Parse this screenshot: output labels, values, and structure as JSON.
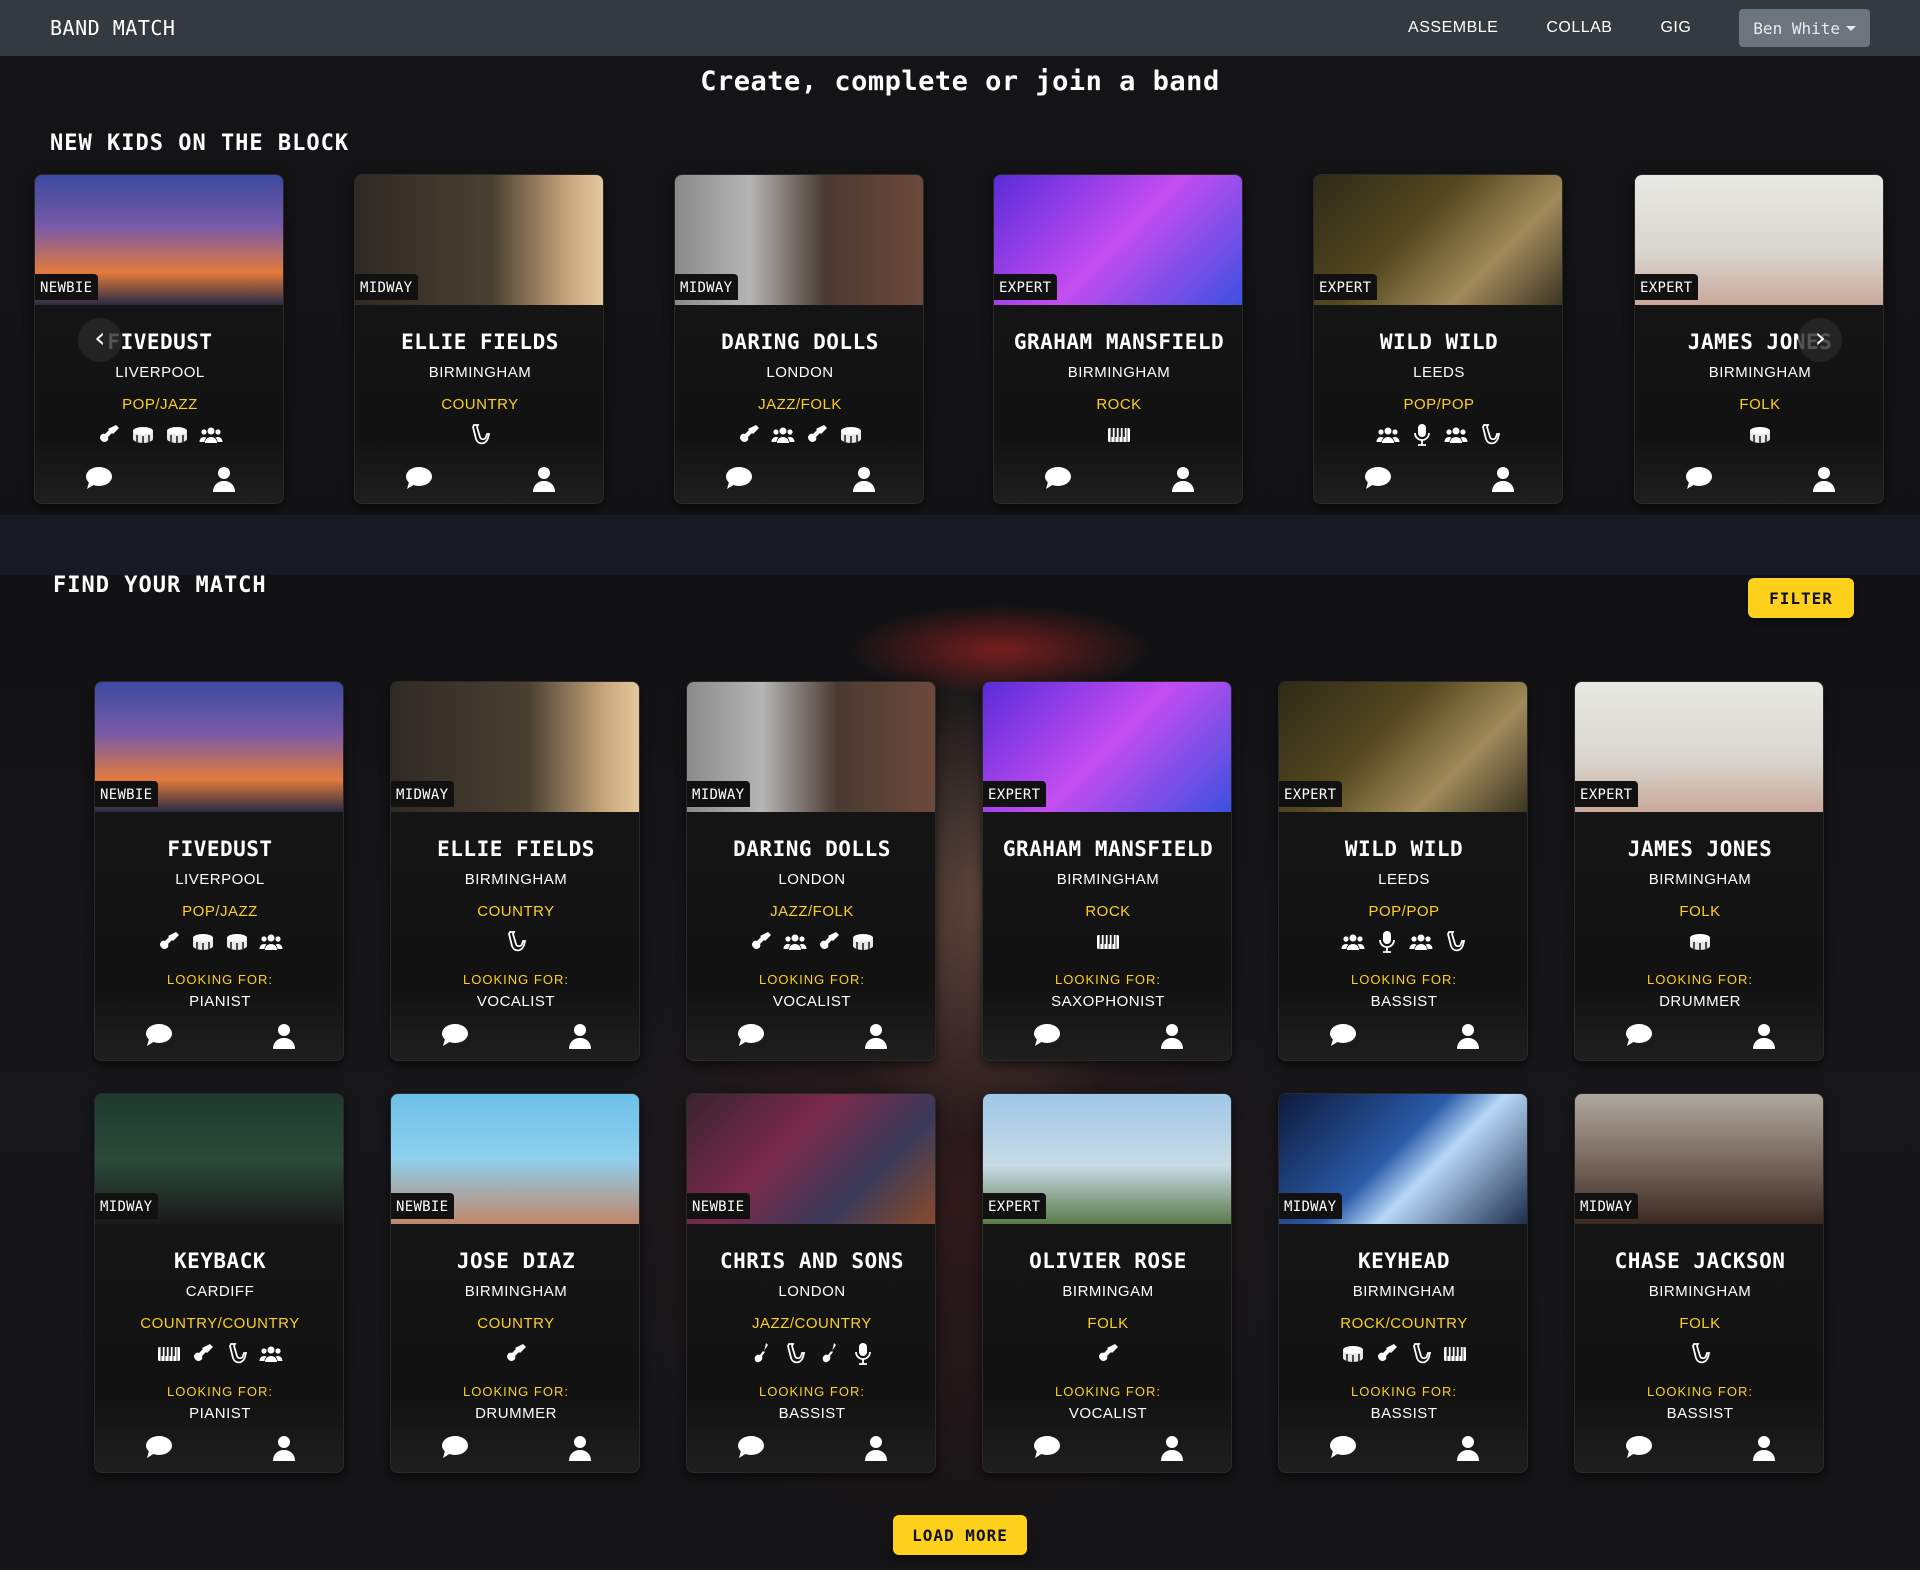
{
  "nav": {
    "brand": "BAND MATCH",
    "links": [
      "ASSEMBLE",
      "COLLAB",
      "GIG"
    ],
    "user": "Ben White"
  },
  "hero_title": "Create, complete or join a band",
  "section_new": "NEW KIDS ON THE BLOCK",
  "section_find": "FIND YOUR MATCH",
  "filter_label": "FILTER",
  "load_more_label": "LOAD MORE",
  "looking_for_label": "LOOKING FOR:",
  "colors": {
    "accent": "#fdd01c",
    "navbar": "#343a40",
    "card": "#151515"
  },
  "new_kids": [
    {
      "level": "NEWBIE",
      "name": "FIVEDUST",
      "city": "LIVERPOOL",
      "genre": "POP/JAZZ",
      "instruments": [
        "guitar-icon",
        "drum-icon",
        "drum-icon",
        "band-icon"
      ]
    },
    {
      "level": "MIDWAY",
      "name": "ELLIE FIELDS",
      "city": "BIRMINGHAM",
      "genre": "COUNTRY",
      "instruments": [
        "saxophone-icon"
      ]
    },
    {
      "level": "MIDWAY",
      "name": "DARING DOLLS",
      "city": "LONDON",
      "genre": "JAZZ/FOLK",
      "instruments": [
        "guitar-icon",
        "band-icon",
        "guitar-icon",
        "drum-icon"
      ]
    },
    {
      "level": "EXPERT",
      "name": "GRAHAM MANSFIELD",
      "city": "BIRMINGHAM",
      "genre": "ROCK",
      "instruments": [
        "keyboard-icon"
      ]
    },
    {
      "level": "EXPERT",
      "name": "WILD WILD",
      "city": "LEEDS",
      "genre": "POP/POP",
      "instruments": [
        "band-icon",
        "microphone-icon",
        "band-icon",
        "saxophone-icon"
      ]
    },
    {
      "level": "EXPERT",
      "name": "JAMES JONES",
      "city": "BIRMINGHAM",
      "genre": "FOLK",
      "instruments": [
        "drum-icon"
      ]
    }
  ],
  "matches": [
    {
      "level": "NEWBIE",
      "name": "FIVEDUST",
      "city": "LIVERPOOL",
      "genre": "POP/JAZZ",
      "instruments": [
        "guitar-icon",
        "drum-icon",
        "drum-icon",
        "band-icon"
      ],
      "seeking": "PIANIST"
    },
    {
      "level": "MIDWAY",
      "name": "ELLIE FIELDS",
      "city": "BIRMINGHAM",
      "genre": "COUNTRY",
      "instruments": [
        "saxophone-icon"
      ],
      "seeking": "VOCALIST"
    },
    {
      "level": "MIDWAY",
      "name": "DARING DOLLS",
      "city": "LONDON",
      "genre": "JAZZ/FOLK",
      "instruments": [
        "guitar-icon",
        "band-icon",
        "guitar-icon",
        "drum-icon"
      ],
      "seeking": "VOCALIST"
    },
    {
      "level": "EXPERT",
      "name": "GRAHAM MANSFIELD",
      "city": "BIRMINGHAM",
      "genre": "ROCK",
      "instruments": [
        "keyboard-icon"
      ],
      "seeking": "SAXOPHONIST"
    },
    {
      "level": "EXPERT",
      "name": "WILD WILD",
      "city": "LEEDS",
      "genre": "POP/POP",
      "instruments": [
        "band-icon",
        "microphone-icon",
        "band-icon",
        "saxophone-icon"
      ],
      "seeking": "BASSIST"
    },
    {
      "level": "EXPERT",
      "name": "JAMES JONES",
      "city": "BIRMINGHAM",
      "genre": "FOLK",
      "instruments": [
        "drum-icon"
      ],
      "seeking": "DRUMMER"
    },
    {
      "level": "MIDWAY",
      "name": "KEYBACK",
      "city": "CARDIFF",
      "genre": "COUNTRY/COUNTRY",
      "instruments": [
        "keyboard-icon",
        "guitar-icon",
        "saxophone-icon",
        "band-icon"
      ],
      "seeking": "PIANIST"
    },
    {
      "level": "NEWBIE",
      "name": "JOSE DIAZ",
      "city": "BIRMINGHAM",
      "genre": "COUNTRY",
      "instruments": [
        "guitar-icon"
      ],
      "seeking": "DRUMMER"
    },
    {
      "level": "NEWBIE",
      "name": "CHRIS AND SONS",
      "city": "LONDON",
      "genre": "JAZZ/COUNTRY",
      "instruments": [
        "bass-icon",
        "saxophone-icon",
        "bass-icon",
        "microphone-icon"
      ],
      "seeking": "BASSIST"
    },
    {
      "level": "EXPERT",
      "name": "OLIVIER ROSE",
      "city": "BIRMINGAM",
      "genre": "FOLK",
      "instruments": [
        "guitar-icon"
      ],
      "seeking": "VOCALIST"
    },
    {
      "level": "MIDWAY",
      "name": "KEYHEAD",
      "city": "BIRMINGHAM",
      "genre": "ROCK/COUNTRY",
      "instruments": [
        "drum-icon",
        "guitar-icon",
        "saxophone-icon",
        "keyboard-icon"
      ],
      "seeking": "BASSIST"
    },
    {
      "level": "MIDWAY",
      "name": "CHASE JACKSON",
      "city": "BIRMINGHAM",
      "genre": "FOLK",
      "instruments": [
        "saxophone-icon"
      ],
      "seeking": "BASSIST"
    }
  ]
}
